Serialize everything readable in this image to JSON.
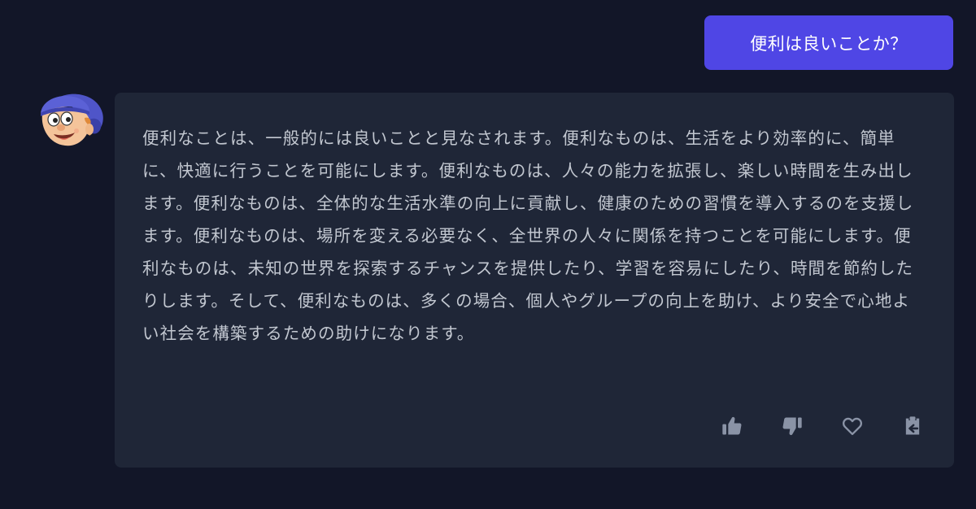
{
  "user_message": {
    "text": "便利は良いことか？"
  },
  "assistant": {
    "avatar_icon": "cartoon-boy-cap-avatar",
    "message": "便利なことは、一般的には良いことと見なされます。便利なものは、生活をより効率的に、簡単に、快適に行うことを可能にします。便利なものは、人々の能力を拡張し、楽しい時間を生み出します。便利なものは、全体的な生活水準の向上に貢献し、健康のための習慣を導入するのを支援します。便利なものは、場所を変える必要なく、全世界の人々に関係を持つことを可能にします。便利なものは、未知の世界を探索するチャンスを提供したり、学習を容易にしたり、時間を節約したりします。そして、便利なものは、多くの場合、個人やグループの向上を助け、より安全で心地よい社会を構築するための助けになります。",
    "actions": [
      {
        "icon": "thumbs-up-icon"
      },
      {
        "icon": "thumbs-down-icon"
      },
      {
        "icon": "heart-icon"
      },
      {
        "icon": "clipboard-icon"
      }
    ]
  },
  "colors": {
    "background": "#121628",
    "user_bubble": "#4f46e5",
    "card": "#1f2637",
    "text": "#c2c7d0",
    "icon": "#8a93a6"
  }
}
